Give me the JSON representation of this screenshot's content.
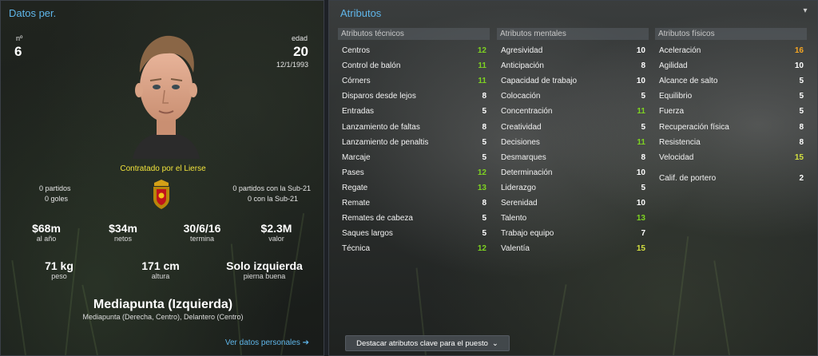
{
  "profile": {
    "title": "Datos per.",
    "number_label": "nº",
    "number": "6",
    "age_label": "edad",
    "age": "20",
    "dob": "12/1/1993",
    "contract_status": "Contratado por el Lierse",
    "apps_left": "0 partidos",
    "goals_left": "0 goles",
    "apps_u21": "0 partidos con la Sub-21",
    "goals_u21": "0 con la Sub-21",
    "finance": [
      {
        "value": "$68m",
        "label": "al año"
      },
      {
        "value": "$34m",
        "label": "netos"
      },
      {
        "value": "30/6/16",
        "label": "termina"
      },
      {
        "value": "$2.3M",
        "label": "valor"
      }
    ],
    "physical": [
      {
        "value": "71 kg",
        "label": "peso"
      },
      {
        "value": "171 cm",
        "label": "altura"
      },
      {
        "value": "Solo izquierda",
        "label": "pierna buena"
      }
    ],
    "position_main": "Mediapunta (Izquierda)",
    "position_other": "Mediapunta (Derecha, Centro), Delantero (Centro)",
    "view_link": "Ver datos personales"
  },
  "attributes": {
    "title": "Atributos",
    "technical": {
      "header": "Atributos técnicos",
      "items": [
        {
          "name": "Centros",
          "value": "12"
        },
        {
          "name": "Control de balón",
          "value": "11"
        },
        {
          "name": "Córners",
          "value": "11"
        },
        {
          "name": "Disparos desde lejos",
          "value": "8"
        },
        {
          "name": "Entradas",
          "value": "5"
        },
        {
          "name": "Lanzamiento de faltas",
          "value": "8"
        },
        {
          "name": "Lanzamiento de penaltis",
          "value": "5"
        },
        {
          "name": "Marcaje",
          "value": "5"
        },
        {
          "name": "Pases",
          "value": "12"
        },
        {
          "name": "Regate",
          "value": "13"
        },
        {
          "name": "Remate",
          "value": "8"
        },
        {
          "name": "Remates de cabeza",
          "value": "5"
        },
        {
          "name": "Saques largos",
          "value": "5"
        },
        {
          "name": "Técnica",
          "value": "12"
        }
      ]
    },
    "mental": {
      "header": "Atributos mentales",
      "items": [
        {
          "name": "Agresividad",
          "value": "10"
        },
        {
          "name": "Anticipación",
          "value": "8"
        },
        {
          "name": "Capacidad de trabajo",
          "value": "10"
        },
        {
          "name": "Colocación",
          "value": "5"
        },
        {
          "name": "Concentración",
          "value": "11"
        },
        {
          "name": "Creatividad",
          "value": "5"
        },
        {
          "name": "Decisiones",
          "value": "11"
        },
        {
          "name": "Desmarques",
          "value": "8"
        },
        {
          "name": "Determinación",
          "value": "10"
        },
        {
          "name": "Liderazgo",
          "value": "5"
        },
        {
          "name": "Serenidad",
          "value": "10"
        },
        {
          "name": "Talento",
          "value": "13"
        },
        {
          "name": "Trabajo equipo",
          "value": "7"
        },
        {
          "name": "Valentía",
          "value": "15"
        }
      ]
    },
    "physical": {
      "header": "Atributos físicos",
      "items": [
        {
          "name": "Aceleración",
          "value": "16"
        },
        {
          "name": "Agilidad",
          "value": "10"
        },
        {
          "name": "Alcance de salto",
          "value": "5"
        },
        {
          "name": "Equilibrio",
          "value": "5"
        },
        {
          "name": "Fuerza",
          "value": "5"
        },
        {
          "name": "Recuperación física",
          "value": "8"
        },
        {
          "name": "Resistencia",
          "value": "8"
        },
        {
          "name": "Velocidad",
          "value": "15"
        }
      ],
      "goalkeeper": {
        "name": "Calif. de portero",
        "value": "2"
      }
    },
    "highlight_button": "Destacar atributos clave para el puesto"
  },
  "colors": {
    "accent": "#5fb6ea",
    "contract": "#f1e33c",
    "value_green": "#7ed321",
    "value_orange": "#f5a623"
  }
}
